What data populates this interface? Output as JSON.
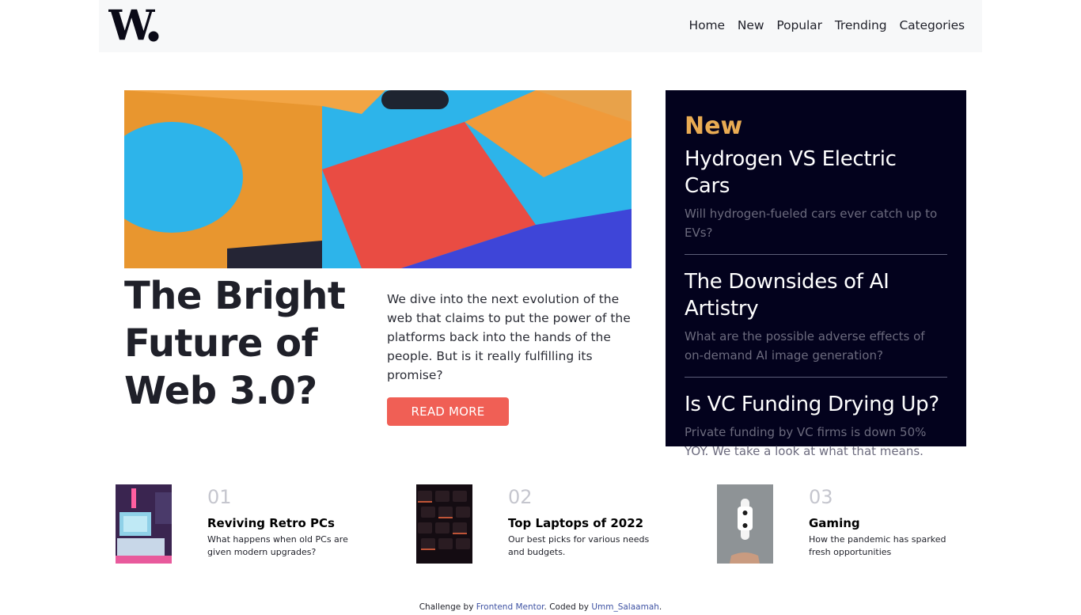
{
  "header": {
    "logo_text": "W.",
    "nav": [
      "Home",
      "New",
      "Popular",
      "Trending",
      "Categories"
    ]
  },
  "hero": {
    "title": "The Bright Future of Web 3.0?",
    "description": "We dive into the next evolution of the web that claims to put the power of the platforms back into the hands of the people. But is it really fulfilling its promise?",
    "button_label": "READ MORE"
  },
  "new_panel": {
    "heading": "New",
    "items": [
      {
        "title": "Hydrogen VS Electric Cars",
        "desc": "Will hydrogen-fueled cars ever catch up to EVs?"
      },
      {
        "title": "The Downsides of AI Artistry",
        "desc": "What are the possible adverse effects of on-demand AI image generation?"
      },
      {
        "title": "Is VC Funding Drying Up?",
        "desc": "Private funding by VC firms is down 50% YOY. We take a look at what that means."
      }
    ]
  },
  "cards": [
    {
      "num": "01",
      "title": "Reviving Retro PCs",
      "desc": "What happens when old PCs are given modern upgrades?"
    },
    {
      "num": "02",
      "title": "Top Laptops of 2022",
      "desc": "Our best picks for various needs and budgets."
    },
    {
      "num": "03",
      "title": "Gaming",
      "desc": "How the pandemic has sparked fresh opportunities"
    }
  ],
  "footer": {
    "prefix": "Challenge by",
    "link1": "Frontend Mentor",
    "middle": ". Coded by",
    "link2": "Umm_Salaamah",
    "suffix": "."
  },
  "colors": {
    "accent": "#f05f55",
    "new_heading": "#e9ab53",
    "panel_bg": "#03021d"
  }
}
